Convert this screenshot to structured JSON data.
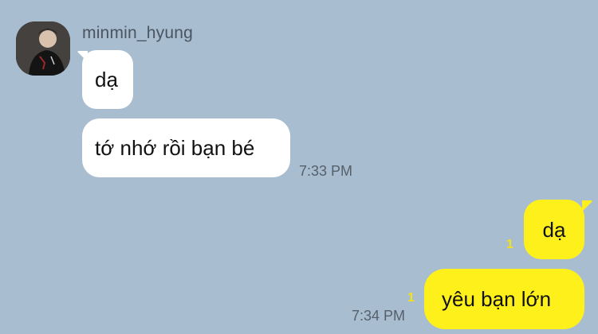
{
  "sender": {
    "name": "minmin_hyung",
    "avatar_icon": "profile-photo-avatar"
  },
  "messages": {
    "incoming": [
      {
        "text": "dạ"
      },
      {
        "text": "tớ nhớ rồi bạn bé",
        "time": "7:33 PM"
      }
    ],
    "outgoing": [
      {
        "text": "dạ",
        "unread": "1"
      },
      {
        "text": "yêu bạn lớn",
        "unread": "1",
        "time": "7:34 PM"
      }
    ]
  },
  "colors": {
    "background": "#a9bdd0",
    "incoming_bubble": "#ffffff",
    "outgoing_bubble": "#fef01b",
    "unread_count": "#f2e21a"
  }
}
